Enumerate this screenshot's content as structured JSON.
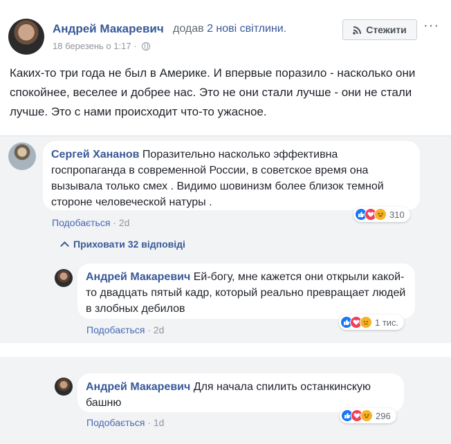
{
  "post": {
    "author": "Андрей Макаревич",
    "action_prefix": "додав ",
    "action_link": "2 нові світлини",
    "action_suffix": ".",
    "timestamp": "18 березень о 1:17 ·",
    "privacy_icon": "globe-icon",
    "follow_label": "Стежити",
    "follow_icon": "rss-icon",
    "more_label": "···",
    "text": "Каких-то три года не был в Америке. И впервые поразило - насколько они спокойнее, веселее и добрее нас. Это не они стали лучше - они не стали лучше. Это с нами происходит что-то ужасное."
  },
  "comments": [
    {
      "author": "Сергей Хананов",
      "text": " Поразительно насколько эффективна госпропаганда в современной России, в советское время она вызывала только смех . Видимо шовинизм более близок темной стороне человеческой натуры .",
      "like_label": "Подобається",
      "separator": " · ",
      "age": "2d",
      "reactions": [
        "like",
        "love",
        "haha"
      ],
      "reaction_count": "310"
    }
  ],
  "hide_replies_label": "Приховати 32 відповіді",
  "replies": [
    {
      "author": "Андрей Макаревич",
      "text": " Ей-богу, мне кажется они открыли какой-то двадцать пятый кадр, который реально превращает людей в злобных дебилов",
      "like_label": "Подобається",
      "separator": " · ",
      "age": "2d",
      "reactions": [
        "like",
        "love",
        "sad"
      ],
      "reaction_count": "1 тис."
    },
    {
      "author": "Андрей Макаревич",
      "text": " Для начала спилить останкинскую башню",
      "like_label": "Подобається",
      "separator": " · ",
      "age": "1d",
      "reactions": [
        "like",
        "love",
        "haha"
      ],
      "reaction_count": "296"
    }
  ],
  "colors": {
    "link": "#385898",
    "like": "#1877f2",
    "love": "#f33e58",
    "haha": "#f7b125"
  }
}
